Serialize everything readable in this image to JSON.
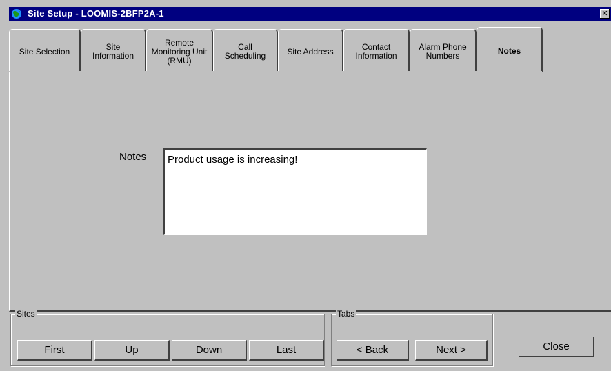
{
  "window": {
    "title": "Site Setup - LOOMIS-2BFP2A-1",
    "close_glyph": "✕",
    "app_icon": "globe-icon"
  },
  "tabs": [
    {
      "label": "Site Selection"
    },
    {
      "label": "Site\nInformation"
    },
    {
      "label": "Remote\nMonitoring Unit\n(RMU)"
    },
    {
      "label": "Call\nScheduling"
    },
    {
      "label": "Site Address"
    },
    {
      "label": "Contact\nInformation"
    },
    {
      "label": "Alarm Phone\nNumbers"
    },
    {
      "label": "Notes",
      "active": true
    }
  ],
  "notes": {
    "label": "Notes",
    "value": "Product usage is increasing!"
  },
  "sites_group": {
    "legend": "Sites",
    "first": {
      "mnemonic": "F",
      "rest": "irst"
    },
    "up": {
      "mnemonic": "U",
      "rest": "p"
    },
    "down": {
      "mnemonic": "D",
      "rest": "own"
    },
    "last": {
      "pre": "",
      "mnemonic": "L",
      "rest": "ast"
    }
  },
  "tabs_group": {
    "legend": "Tabs",
    "back": {
      "pre": "< ",
      "mnemonic": "B",
      "rest": "ack"
    },
    "next": {
      "mnemonic": "N",
      "rest": "ext >"
    }
  },
  "close_label": "Close"
}
